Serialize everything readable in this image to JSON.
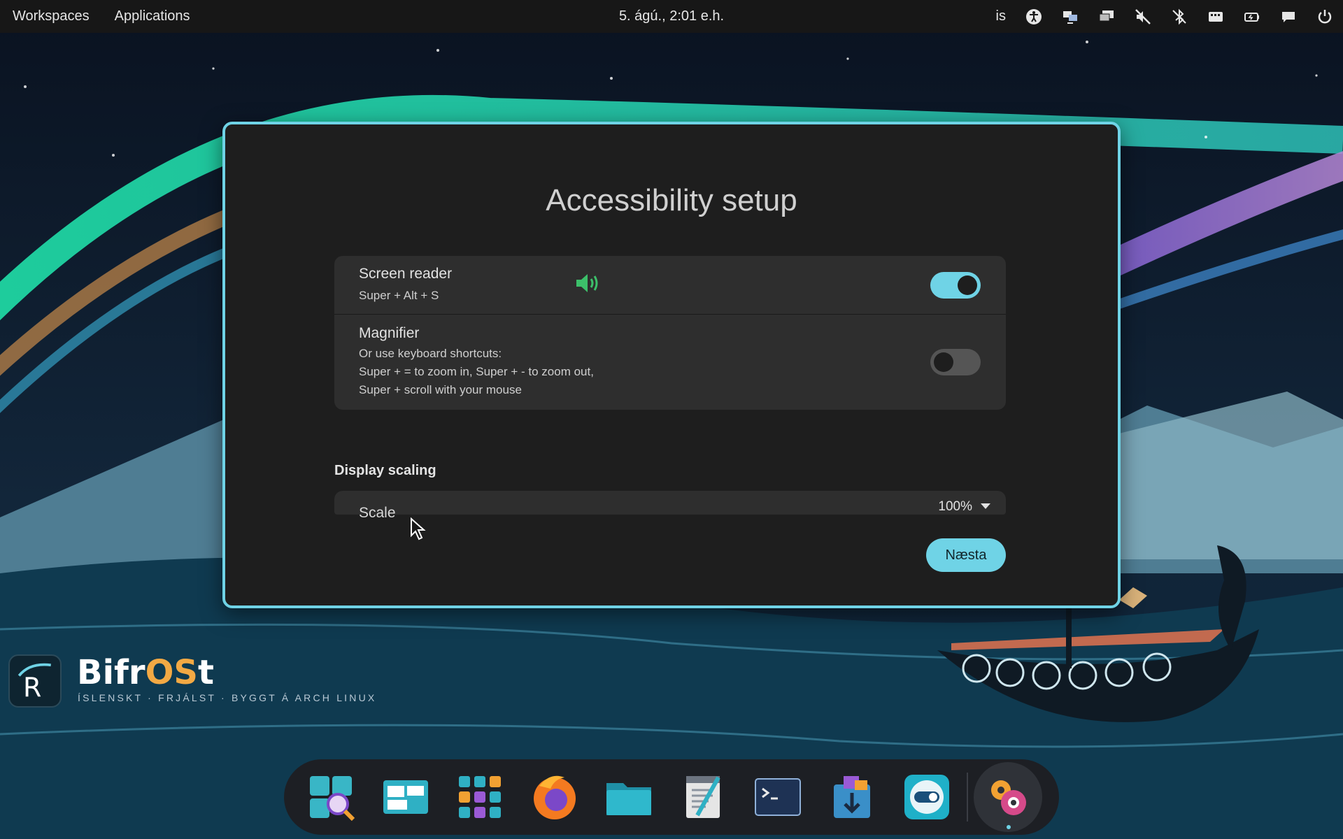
{
  "topbar": {
    "workspaces": "Workspaces",
    "applications": "Applications",
    "clock": "5. ágú., 2:01 e.h.",
    "language": "is",
    "tray_icons": [
      "accessibility-icon",
      "network-icon",
      "displays-icon",
      "volume-muted-icon",
      "bluetooth-off-icon",
      "keyboard-icon",
      "battery-icon",
      "notifications-icon",
      "power-icon"
    ]
  },
  "dialog": {
    "title": "Accessibility setup",
    "screen_reader": {
      "title": "Screen reader",
      "shortcut": "Super + Alt + S",
      "enabled": true
    },
    "magnifier": {
      "title": "Magnifier",
      "line1": "Or use keyboard shortcuts:",
      "line2": "Super + = to zoom in, Super + - to zoom out,",
      "line3": "Super + scroll with your mouse",
      "enabled": false
    },
    "display_scaling": {
      "label": "Display scaling",
      "scale_label": "Scale",
      "scale_value": "100%"
    },
    "next_button": "Næsta"
  },
  "brand": {
    "name_part1": "Bifr",
    "name_part2": "OS",
    "name_part3": "t",
    "tagline": "ÍSLENSKT · FRJÁLST · BYGGT Á ARCH LINUX"
  },
  "dock": {
    "items": [
      "search-app-icon",
      "window-switcher-icon",
      "app-grid-icon",
      "firefox-icon",
      "files-icon",
      "text-editor-icon",
      "terminal-icon",
      "software-installer-icon",
      "settings-toggle-icon",
      "system-settings-icon"
    ]
  },
  "colors": {
    "accent": "#6fd3e6",
    "brand_orange": "#f3a944",
    "dialog_bg": "#1e1e1e",
    "card_bg": "#2e2e2e"
  }
}
